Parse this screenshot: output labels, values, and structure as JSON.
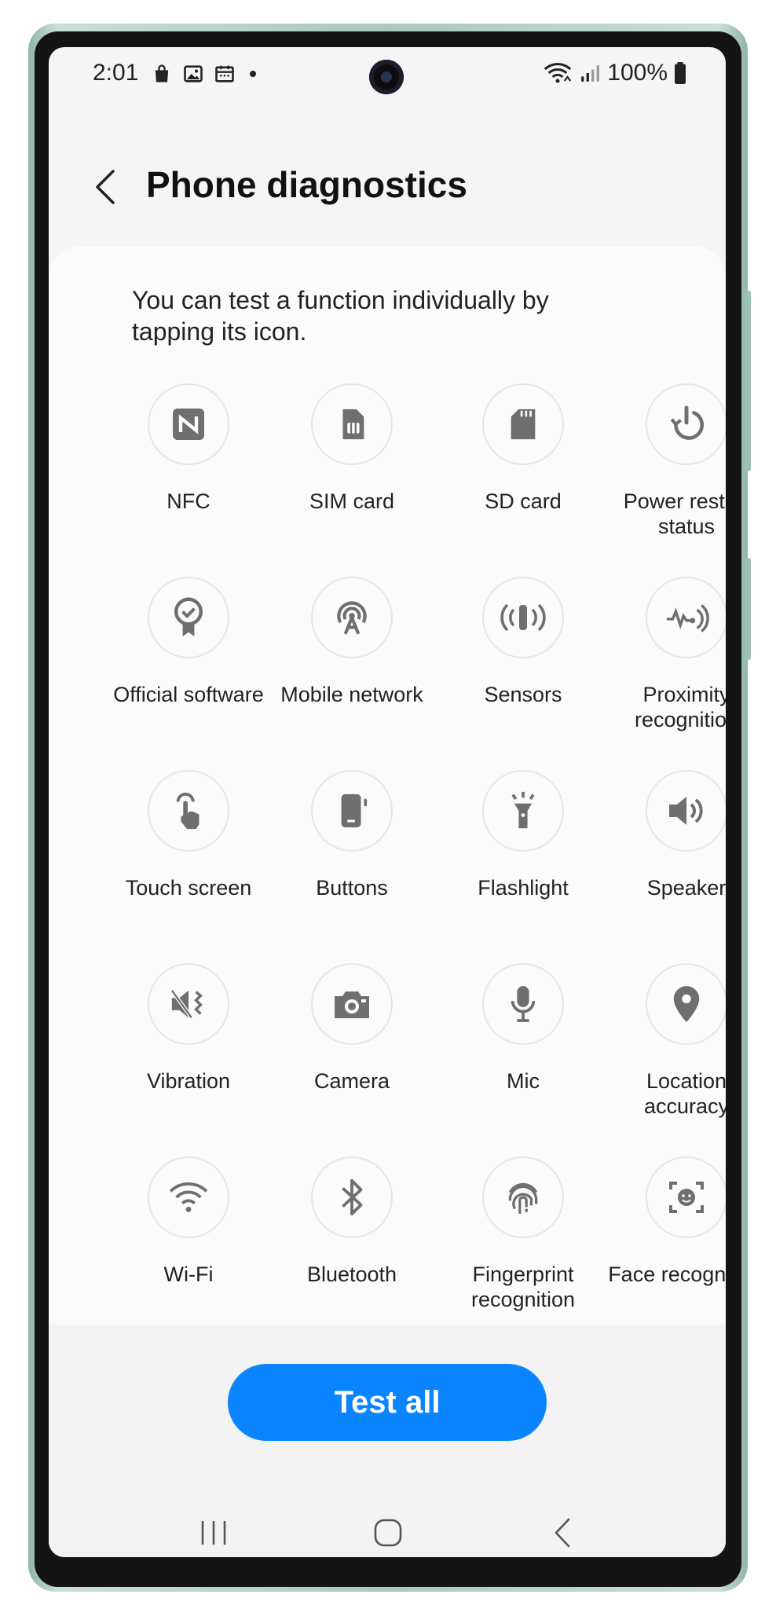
{
  "status_bar": {
    "time": "2:01",
    "battery": "100%"
  },
  "header": {
    "title": "Phone diagnostics"
  },
  "description": "You can test a function individually by tapping its icon.",
  "tests": [
    {
      "label": "NFC",
      "icon": "nfc-icon"
    },
    {
      "label": "SIM card",
      "icon": "sim-card-icon"
    },
    {
      "label": "SD card",
      "icon": "sd-card-icon"
    },
    {
      "label": "Power restart status",
      "icon": "power-restart-icon"
    },
    {
      "label": "Official software",
      "icon": "official-software-icon"
    },
    {
      "label": "Mobile network",
      "icon": "mobile-network-icon"
    },
    {
      "label": "Sensors",
      "icon": "sensors-icon"
    },
    {
      "label": "Proximity recognition",
      "icon": "proximity-icon"
    },
    {
      "label": "Touch screen",
      "icon": "touch-screen-icon"
    },
    {
      "label": "Buttons",
      "icon": "buttons-icon"
    },
    {
      "label": "Flashlight",
      "icon": "flashlight-icon"
    },
    {
      "label": "Speaker",
      "icon": "speaker-icon"
    },
    {
      "label": "Vibration",
      "icon": "vibration-icon"
    },
    {
      "label": "Camera",
      "icon": "camera-icon"
    },
    {
      "label": "Mic",
      "icon": "mic-icon"
    },
    {
      "label": "Location accuracy",
      "icon": "location-icon"
    },
    {
      "label": "Wi-Fi",
      "icon": "wifi-icon"
    },
    {
      "label": "Bluetooth",
      "icon": "bluetooth-icon"
    },
    {
      "label": "Fingerprint recognition",
      "icon": "fingerprint-icon"
    },
    {
      "label": "Face recognition",
      "icon": "face-recognition-icon"
    }
  ],
  "test_all_label": "Test all",
  "colors": {
    "accent": "#0a84ff",
    "icon": "#6f6f6f",
    "background": "#f5f5f5"
  }
}
